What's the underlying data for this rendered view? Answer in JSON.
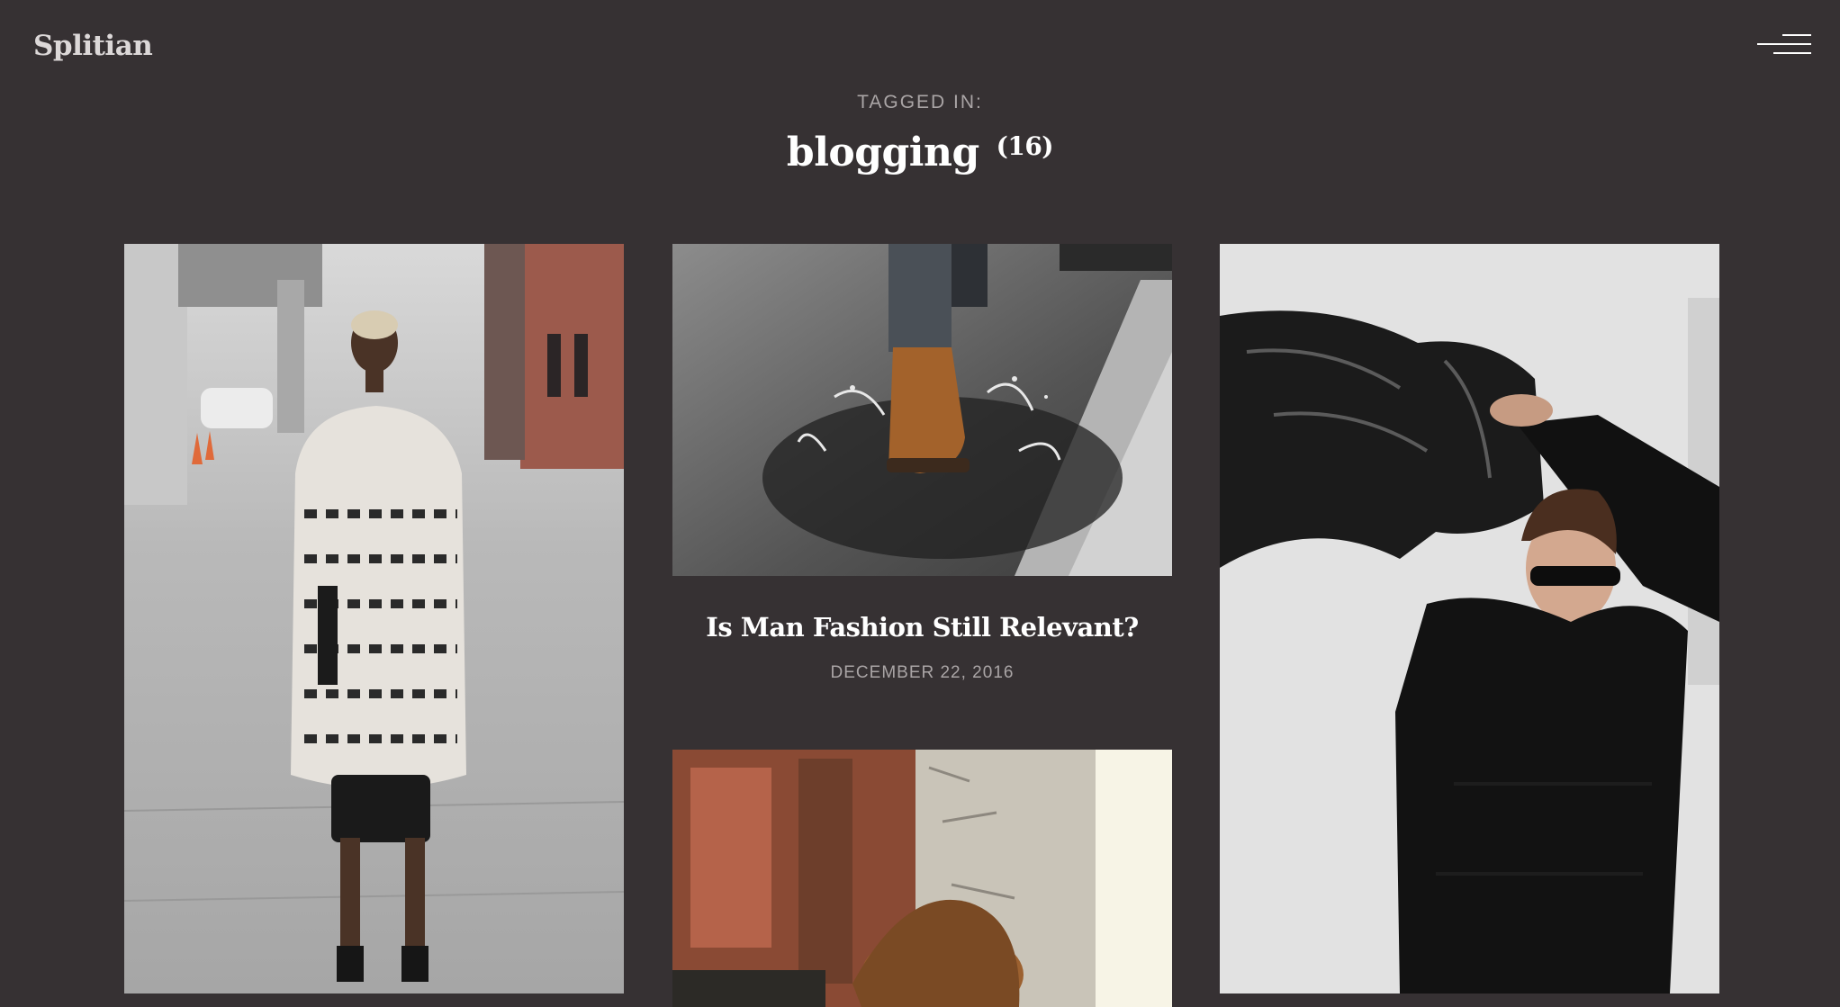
{
  "site": {
    "logo": "Splitian",
    "menu_icon": "hamburger-menu-icon"
  },
  "archive": {
    "label": "TAGGED IN:",
    "tag": "blogging",
    "count": "(16)"
  },
  "posts": [
    {
      "image": "woman-street-knit-cardigan-photo",
      "title": "",
      "date": ""
    },
    {
      "image": "boot-splashing-puddle-photo",
      "title": "Is Man Fashion Still Relevant?",
      "date": "DECEMBER 22, 2016"
    },
    {
      "image": "man-black-sweater-leather-jacket-photo",
      "title": "",
      "date": ""
    },
    {
      "image": "man-rusty-wall-photo",
      "title": "",
      "date": ""
    }
  ],
  "colors": {
    "background": "#363133",
    "text": "#ffffff",
    "muted": "#aaa5a6"
  }
}
